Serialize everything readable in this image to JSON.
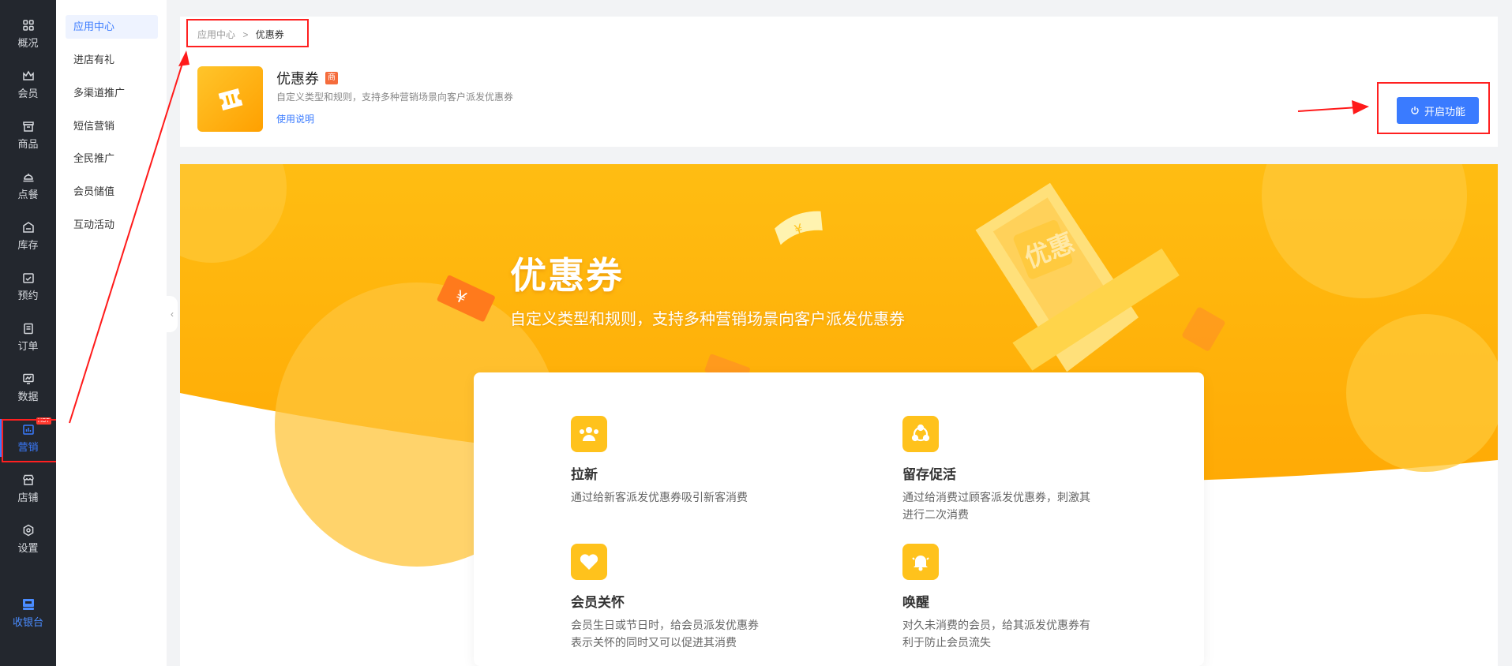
{
  "rail": {
    "items": [
      {
        "label": "概况",
        "icon": "grid-icon"
      },
      {
        "label": "会员",
        "icon": "crown-icon"
      },
      {
        "label": "商品",
        "icon": "store-box-icon"
      },
      {
        "label": "点餐",
        "icon": "cloche-icon"
      },
      {
        "label": "库存",
        "icon": "inventory-icon"
      },
      {
        "label": "预约",
        "icon": "calendar-check-icon"
      },
      {
        "label": "订单",
        "icon": "clipboard-icon"
      },
      {
        "label": "数据",
        "icon": "monitor-chart-icon"
      },
      {
        "label": "营销",
        "icon": "marketing-icon",
        "badge": "HOT"
      },
      {
        "label": "店铺",
        "icon": "shop-icon"
      },
      {
        "label": "设置",
        "icon": "settings-icon"
      }
    ],
    "cashier": {
      "label": "收银台",
      "icon": "cashier-icon"
    }
  },
  "submenu": {
    "items": [
      "应用中心",
      "进店有礼",
      "多渠道推广",
      "短信营销",
      "全民推广",
      "会员储值",
      "互动活动"
    ]
  },
  "breadcrumb": {
    "parent": "应用中心",
    "separator": ">",
    "current": "优惠券"
  },
  "app": {
    "title": "优惠券",
    "tag": "商",
    "description": "自定义类型和规则，支持多种营销场景向客户派发优惠券",
    "help_link": "使用说明",
    "enable_button": "开启功能"
  },
  "banner": {
    "title": "优惠券",
    "subtitle": "自定义类型和规则，支持多种营销场景向客户派发优惠券",
    "coupon_text": "优惠"
  },
  "features": [
    {
      "title": "拉新",
      "desc": "通过给新客派发优惠券吸引新客消费",
      "icon": "users-icon"
    },
    {
      "title": "留存促活",
      "desc": "通过给消费过顾客派发优惠券，刺激其进行二次消费",
      "icon": "share-cycle-icon"
    },
    {
      "title": "会员关怀",
      "desc": "会员生日或节日时，给会员派发优惠券表示关怀的同时又可以促进其消费",
      "icon": "heart-icon"
    },
    {
      "title": "唤醒",
      "desc": "对久未消费的会员，给其派发优惠券有利于防止会员流失",
      "icon": "bell-icon"
    }
  ],
  "colors": {
    "primary": "#3a7bff",
    "banner": "#ffb400",
    "feature_icon": "#ffc21c",
    "annotation": "#ff2020"
  }
}
